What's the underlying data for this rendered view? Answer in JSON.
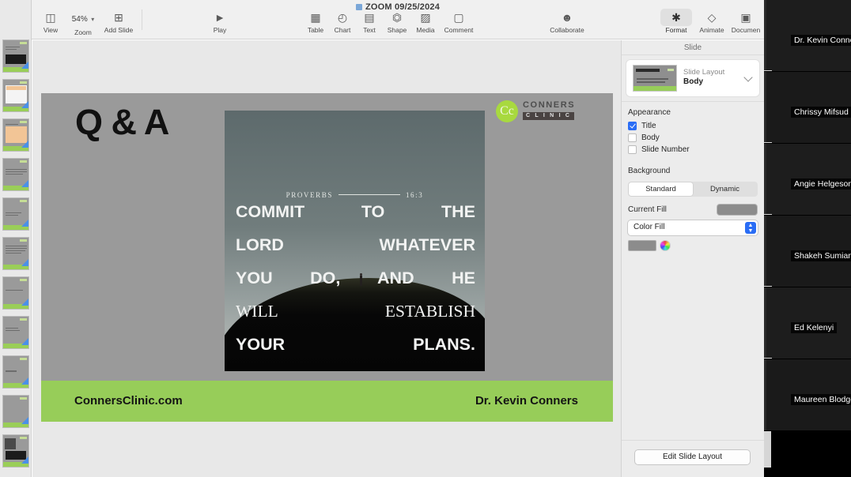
{
  "app": {
    "document_title": "ZOOM 09/25/2024",
    "doc_icon": "keynote-document-icon"
  },
  "toolbar": {
    "view": {
      "label": "View",
      "icon": "sidebar-panel-icon"
    },
    "zoom": {
      "label": "Zoom",
      "value": "54%",
      "chevron": "chevron-down-icon"
    },
    "add_slide": {
      "label": "Add Slide",
      "icon": "plus-square-icon"
    },
    "play": {
      "label": "Play",
      "icon": "play-triangle-icon"
    },
    "table": {
      "label": "Table",
      "icon": "table-grid-icon"
    },
    "chart": {
      "label": "Chart",
      "icon": "pie-chart-icon"
    },
    "text": {
      "label": "Text",
      "icon": "text-box-icon"
    },
    "shape": {
      "label": "Shape",
      "icon": "shape-icon"
    },
    "media": {
      "label": "Media",
      "icon": "photo-icon"
    },
    "comment": {
      "label": "Comment",
      "icon": "comment-bubble-icon"
    },
    "collaborate": {
      "label": "Collaborate",
      "icon": "collaborate-person-icon"
    },
    "format": {
      "label": "Format",
      "icon": "paintbrush-icon"
    },
    "animate": {
      "label": "Animate",
      "icon": "diamond-icon"
    },
    "document": {
      "label": "Documen",
      "icon": "document-icon"
    }
  },
  "slide": {
    "title": "Q & A",
    "logo": {
      "monogram": "Cc",
      "name": "CONNERS",
      "sub": "C L I N I C",
      "circle_color": "#a8d93f"
    },
    "photo": {
      "reference_book": "PROVERBS",
      "reference_verse": "16:3",
      "quote_lines": [
        "COMMIT TO THE",
        "LORD WHATEVER",
        "YOU DO, AND HE",
        "WILL ESTABLISH",
        "YOUR PLANS."
      ],
      "alt": "person standing on dark hilltop at dusk"
    },
    "footer": {
      "website": "ConnersClinic.com",
      "presenter": "Dr. Kevin Conners",
      "band_color": "#97cd59"
    }
  },
  "inspector": {
    "header": "Slide",
    "layout": {
      "label": "Slide Layout",
      "value": "Body",
      "chevron": "chevron-down-icon"
    },
    "appearance": {
      "title": "Appearance",
      "options": [
        {
          "label": "Title",
          "checked": true
        },
        {
          "label": "Body",
          "checked": false
        },
        {
          "label": "Slide Number",
          "checked": false
        }
      ]
    },
    "background": {
      "title": "Background",
      "segments": [
        {
          "label": "Standard",
          "selected": true
        },
        {
          "label": "Dynamic",
          "selected": false
        }
      ],
      "current_fill_label": "Current Fill",
      "current_fill_color": "#8c8c8c",
      "fill_type": "Color Fill",
      "swatch_color": "#8c8c8c"
    },
    "edit_layout_button": "Edit Slide Layout"
  },
  "zoom_panel": {
    "participants": [
      {
        "name": "Dr. Kevin Conners"
      },
      {
        "name": "Chrissy Mifsud"
      },
      {
        "name": "Angie Helgeson"
      },
      {
        "name": "Shakeh Sumian"
      },
      {
        "name": "Ed Kelenyi"
      },
      {
        "name": "Maureen Blodgett"
      }
    ]
  }
}
